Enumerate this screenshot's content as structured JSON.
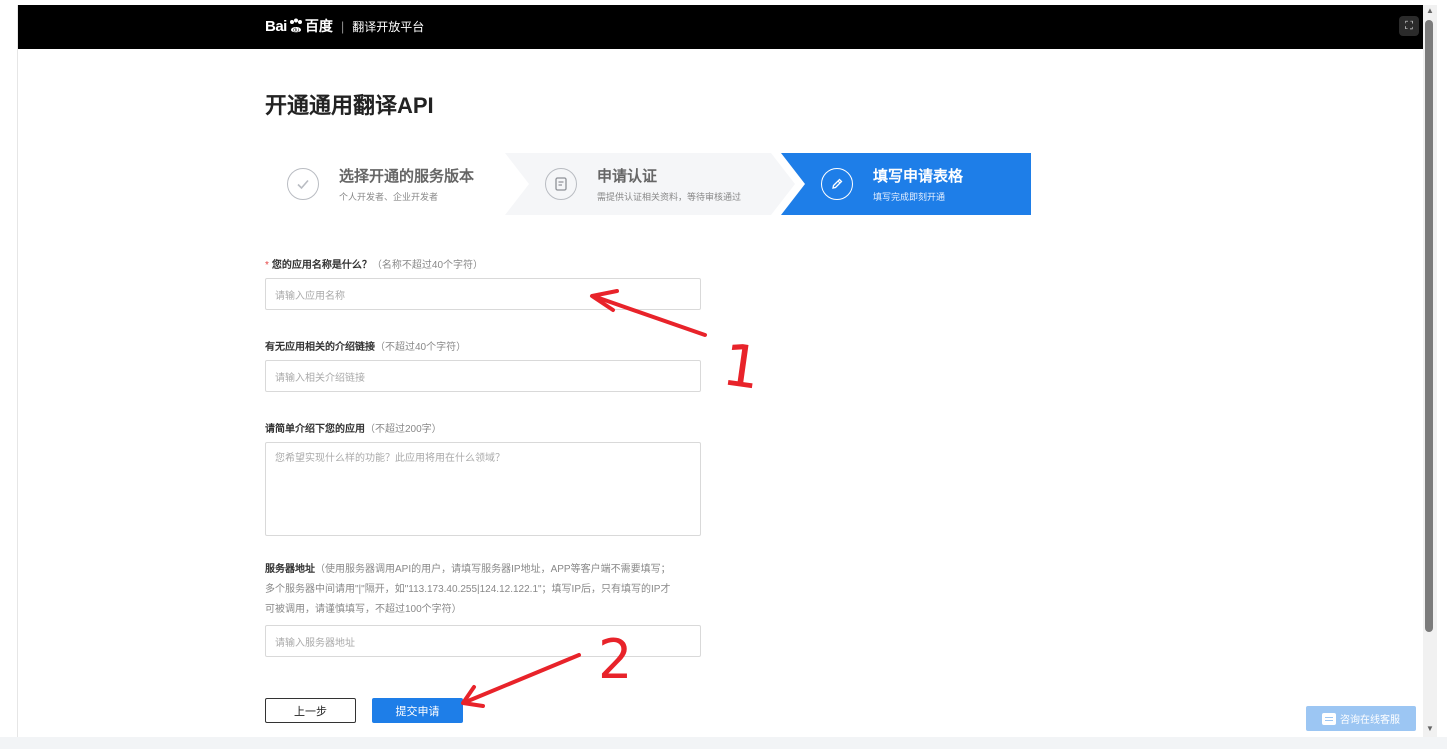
{
  "header": {
    "logo_bai": "Bai",
    "logo_du": "百度",
    "separator": "|",
    "platform": "翻译开放平台",
    "corner_icon": "fit-screen-icon"
  },
  "page": {
    "title": "开通通用翻译API"
  },
  "steps": [
    {
      "title": "选择开通的服务版本",
      "subtitle": "个人开发者、企业开发者",
      "icon": "check-icon"
    },
    {
      "title": "申请认证",
      "subtitle": "需提供认证相关资料，等待审核通过",
      "icon": "document-icon"
    },
    {
      "title": "填写申请表格",
      "subtitle": "填写完成即刻开通",
      "icon": "edit-icon"
    }
  ],
  "form": {
    "app_name": {
      "required_mark": "*",
      "label": "您的应用名称是什么？",
      "hint": "（名称不超过40个字符）",
      "placeholder": "请输入应用名称"
    },
    "intro_link": {
      "label": "有无应用相关的介绍链接",
      "hint": "（不超过40个字符）",
      "placeholder": "请输入相关介绍链接"
    },
    "description": {
      "label": "请简单介绍下您的应用",
      "hint": "（不超过200字）",
      "placeholder": "您希望实现什么样的功能？此应用将用在什么领域？"
    },
    "server": {
      "label": "服务器地址",
      "hint_line1": "（使用服务器调用API的用户，请填写服务器IP地址，APP等客户端不需要填写；",
      "hint_line2": "多个服务器中间请用\"|\"隔开，如\"113.173.40.255|124.12.122.1\"；填写IP后，只有填写的IP才",
      "hint_line3": "可被调用，请谨慎填写，不超过100个字符）",
      "placeholder": "请输入服务器地址"
    }
  },
  "buttons": {
    "prev": "上一步",
    "submit": "提交申请"
  },
  "chat": {
    "label": "咨询在线客服",
    "icon": "chat-icon"
  },
  "annotations": {
    "mark1": "1",
    "mark2": "2",
    "color": "#e8232a"
  }
}
